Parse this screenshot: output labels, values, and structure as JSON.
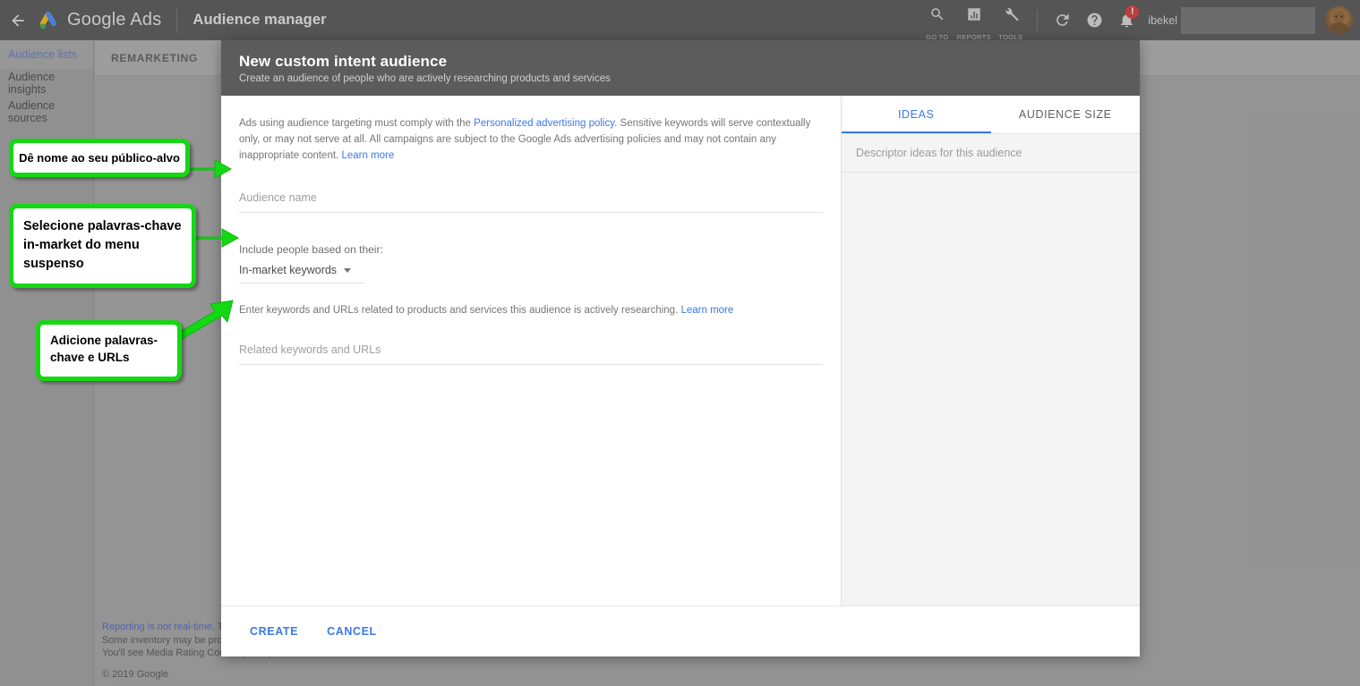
{
  "topbar": {
    "back_icon": "back-arrow-icon",
    "brand": "Google Ads",
    "page_title": "Audience manager",
    "tools": [
      {
        "icon": "search-icon",
        "label": "GO TO"
      },
      {
        "icon": "reports-bar-chart-icon",
        "label": "REPORTS"
      },
      {
        "icon": "wrench-tools-icon",
        "label": "TOOLS"
      }
    ],
    "refresh_icon": "refresh-icon",
    "help_icon": "help-circle-icon",
    "bell_icon": "notification-bell-icon",
    "bell_badge": "!",
    "username": "ibekel"
  },
  "sidebar": {
    "items": [
      {
        "label": "Audience lists",
        "active": true
      },
      {
        "label": "Audience insights",
        "active": false
      },
      {
        "label": "Audience sources",
        "active": false
      }
    ]
  },
  "main": {
    "tabs": [
      {
        "label": "REMARKETING"
      }
    ],
    "footer": {
      "line1_link": "Reporting is not real-time.",
      "line1_rest": " Time",
      "line2": "Some inventory may be provide",
      "line3": "You'll see Media Rating Council (MRC) accreditation noted in the column header's hover text for accredited metrics.",
      "copyright": "© 2019 Google"
    }
  },
  "dialog": {
    "title": "New custom intent audience",
    "subtitle": "Create an audience of people who are actively researching products and services",
    "policy": {
      "pre": "Ads using audience targeting must comply with the ",
      "link1": "Personalized advertising policy",
      "mid": ". Sensitive keywords will serve contextually only, or may not serve at all. All campaigns are subject to the Google Ads advertising policies and may not contain any inappropriate content. ",
      "link2": "Learn more"
    },
    "audience_name": {
      "placeholder": "Audience name",
      "value": ""
    },
    "include_label": "Include people based on their:",
    "include_select": {
      "value": "In-market keywords"
    },
    "keywords_hint": {
      "text": "Enter keywords and URLs related to products and services this audience is actively researching. ",
      "link": "Learn more"
    },
    "related_keywords": {
      "placeholder": "Related keywords and URLs",
      "value": ""
    },
    "right_tabs": [
      {
        "label": "IDEAS",
        "active": true
      },
      {
        "label": "AUDIENCE SIZE",
        "active": false
      }
    ],
    "right_panel_header": "Descriptor ideas for this audience",
    "buttons": {
      "create": "CREATE",
      "cancel": "CANCEL"
    }
  },
  "annotations": [
    {
      "text": "Dê nome ao seu público-alvo"
    },
    {
      "text": "Selecione palavras-chave in-market do menu suspenso"
    },
    {
      "text": "Adicione palavras-chave e URLs"
    }
  ],
  "colors": {
    "accent_blue": "#3b78e7",
    "annotation_green": "#14d814",
    "topbar_gray": "#4c4c4c",
    "badge_red": "#d32f2f"
  }
}
